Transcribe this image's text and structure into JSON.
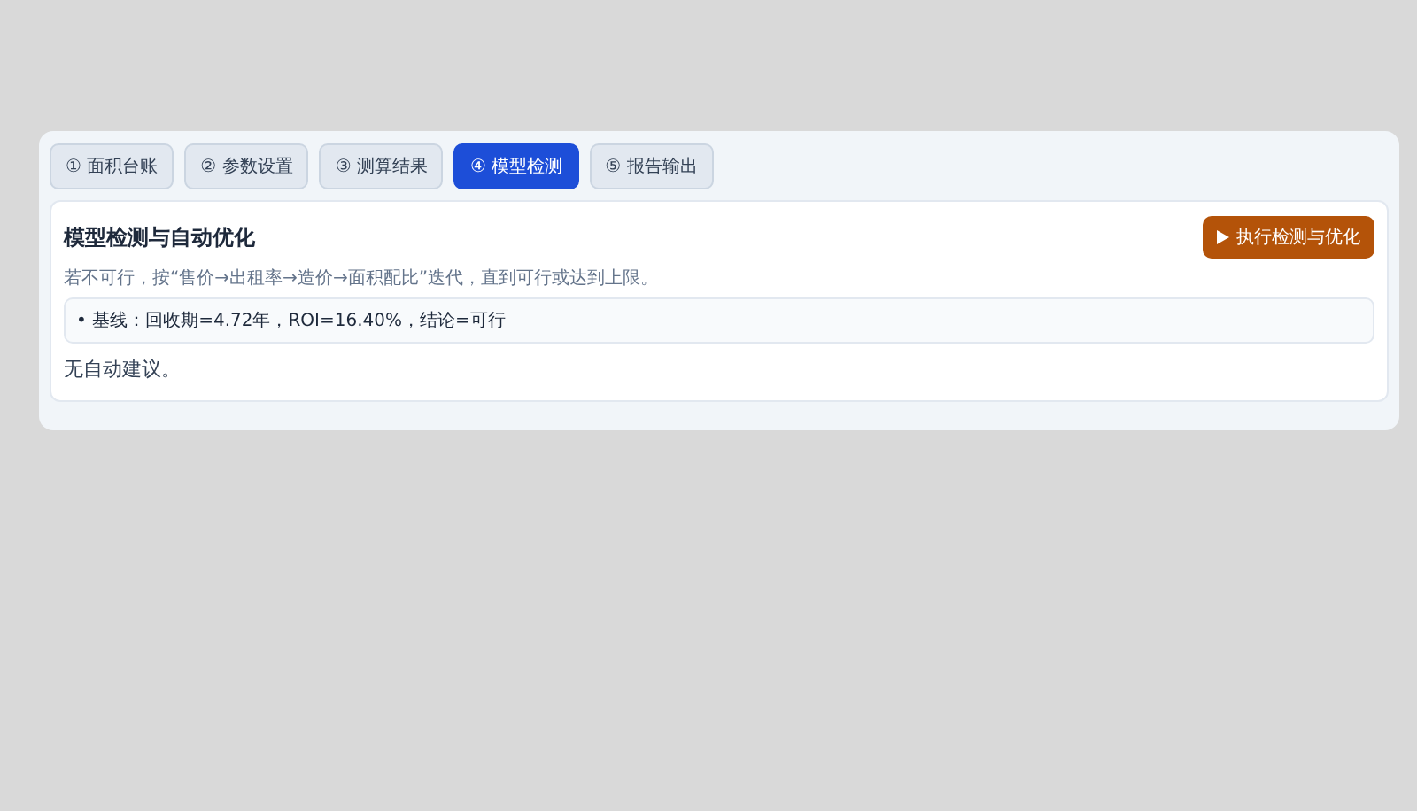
{
  "tabs": [
    {
      "label": "① 面积台账",
      "selected": false
    },
    {
      "label": "② 参数设置",
      "selected": false
    },
    {
      "label": "③ 测算结果",
      "selected": false
    },
    {
      "label": "④ 模型检测",
      "selected": true
    },
    {
      "label": "⑤ 报告输出",
      "selected": false
    }
  ],
  "card": {
    "title": "模型检测与自动优化",
    "run_button": "执行检测与优化",
    "hint": "若不可行，按“售价→出租率→造价→面积配比”迭代，直到可行或达到上限。",
    "baseline": "• 基线：回收期=4.72年，ROI=16.40%，结论=可行",
    "message": "无自动建议。"
  }
}
